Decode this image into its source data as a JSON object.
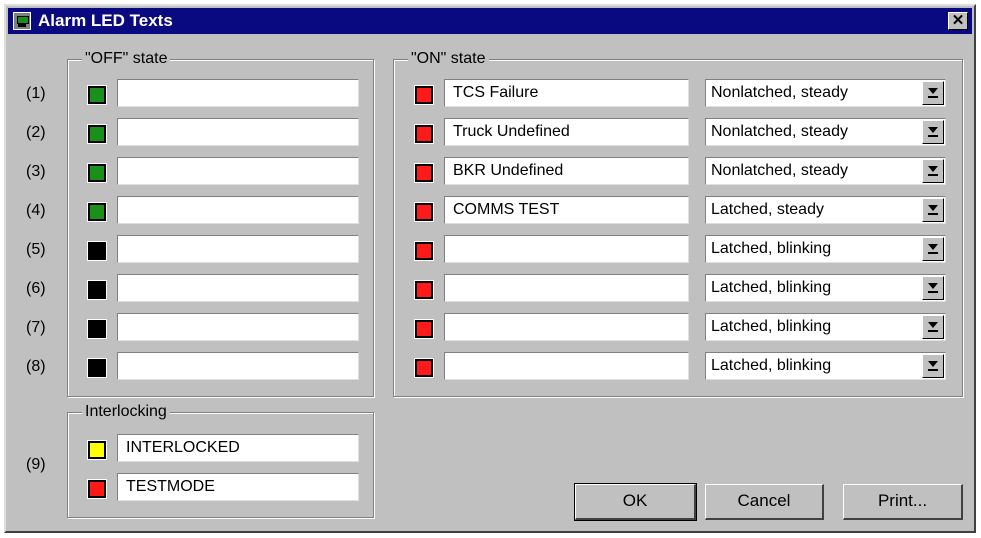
{
  "window": {
    "title": "Alarm LED Texts",
    "close_label": "✕"
  },
  "off_group": {
    "label": "\"OFF\" state"
  },
  "on_group": {
    "label": "\"ON\" state"
  },
  "interlock_group": {
    "label": "Interlocking"
  },
  "rows": [
    {
      "label": "(1)",
      "off_color": "#1a8f1a",
      "off_text": "",
      "on_color": "#ff1a1a",
      "on_text": "TCS Failure",
      "mode": "Nonlatched, steady"
    },
    {
      "label": "(2)",
      "off_color": "#1a8f1a",
      "off_text": "",
      "on_color": "#ff1a1a",
      "on_text": "Truck Undefined",
      "mode": "Nonlatched, steady"
    },
    {
      "label": "(3)",
      "off_color": "#1a8f1a",
      "off_text": "",
      "on_color": "#ff1a1a",
      "on_text": "BKR Undefined",
      "mode": "Nonlatched, steady"
    },
    {
      "label": "(4)",
      "off_color": "#1a8f1a",
      "off_text": "",
      "on_color": "#ff1a1a",
      "on_text": "COMMS TEST",
      "mode": "Latched, steady"
    },
    {
      "label": "(5)",
      "off_color": "#000000",
      "off_text": "",
      "on_color": "#ff1a1a",
      "on_text": "",
      "mode": "Latched, blinking"
    },
    {
      "label": "(6)",
      "off_color": "#000000",
      "off_text": "",
      "on_color": "#ff1a1a",
      "on_text": "",
      "mode": "Latched, blinking"
    },
    {
      "label": "(7)",
      "off_color": "#000000",
      "off_text": "",
      "on_color": "#ff1a1a",
      "on_text": "",
      "mode": "Latched, blinking"
    },
    {
      "label": "(8)",
      "off_color": "#000000",
      "off_text": "",
      "on_color": "#ff1a1a",
      "on_text": "",
      "mode": "Latched, blinking"
    }
  ],
  "interlock": {
    "label": "(9)",
    "items": [
      {
        "color": "#ffff00",
        "text": "INTERLOCKED"
      },
      {
        "color": "#ff1a1a",
        "text": "TESTMODE"
      }
    ]
  },
  "buttons": {
    "ok": "OK",
    "cancel": "Cancel",
    "print": "Print..."
  }
}
